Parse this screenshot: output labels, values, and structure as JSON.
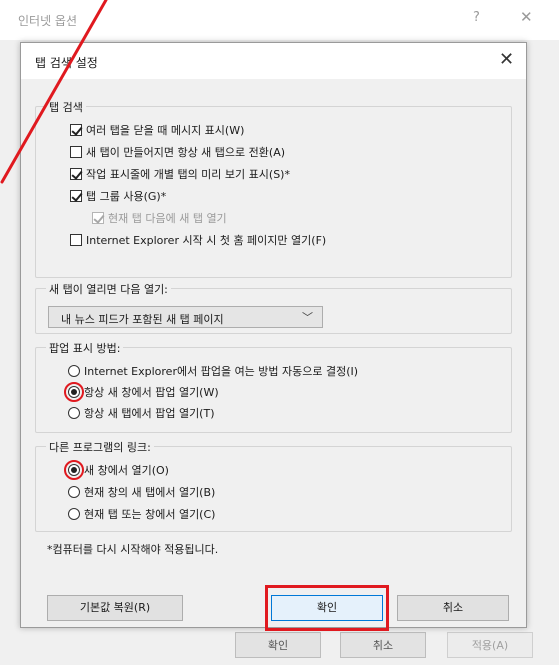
{
  "parent": {
    "title": "인터넷 옵션",
    "help_glyph": "?",
    "close_glyph": "✕",
    "buttons": {
      "ok": "확인",
      "cancel": "취소",
      "apply": "적용(A)"
    }
  },
  "dialog": {
    "title": "탭 검색 설정",
    "close_glyph": "✕",
    "tab_browsing": {
      "label": "탭 검색",
      "options": [
        {
          "label": "여러 탭을 닫을 때 메시지 표시(W)",
          "checked": true,
          "disabled": false
        },
        {
          "label": "새 탭이 만들어지면 항상 새 탭으로 전환(A)",
          "checked": false,
          "disabled": false
        },
        {
          "label": "작업 표시줄에 개별 탭의 미리 보기 표시(S)*",
          "checked": true,
          "disabled": false
        },
        {
          "label": "탭 그룹 사용(G)*",
          "checked": true,
          "disabled": false
        },
        {
          "label": "현재 탭 다음에 새 탭 열기",
          "checked": true,
          "disabled": true
        },
        {
          "label": "Internet Explorer 시작 시 첫 홈 페이지만 열기(F)",
          "checked": false,
          "disabled": false
        }
      ]
    },
    "new_tab": {
      "label": "새 탭이 열리면 다음 열기:",
      "selected": "내 뉴스 피드가 포함된 새 탭 페이지",
      "chevron_glyph": "﹀"
    },
    "popups": {
      "label": "팝업 표시 방법:",
      "options": [
        {
          "label": "Internet Explorer에서 팝업을 여는 방법 자동으로 결정(I)",
          "checked": false
        },
        {
          "label": "항상 새 창에서 팝업 열기(W)",
          "checked": true
        },
        {
          "label": "항상 새 탭에서 팝업 열기(T)",
          "checked": false
        }
      ]
    },
    "links": {
      "label": "다른 프로그램의 링크:",
      "options": [
        {
          "label": "새 창에서 열기(O)",
          "checked": true
        },
        {
          "label": "현재 창의 새 탭에서 열기(B)",
          "checked": false
        },
        {
          "label": "현재 탭 또는 창에서 열기(C)",
          "checked": false
        }
      ]
    },
    "note": "*컴퓨터를 다시 시작해야 적용됩니다.",
    "buttons": {
      "restore": "기본값 복원(R)",
      "ok": "확인",
      "cancel": "취소"
    }
  },
  "colors": {
    "annotation_red": "#e0191f",
    "dialog_bg": "#f0f0f0",
    "primary_border": "#0078d7"
  }
}
